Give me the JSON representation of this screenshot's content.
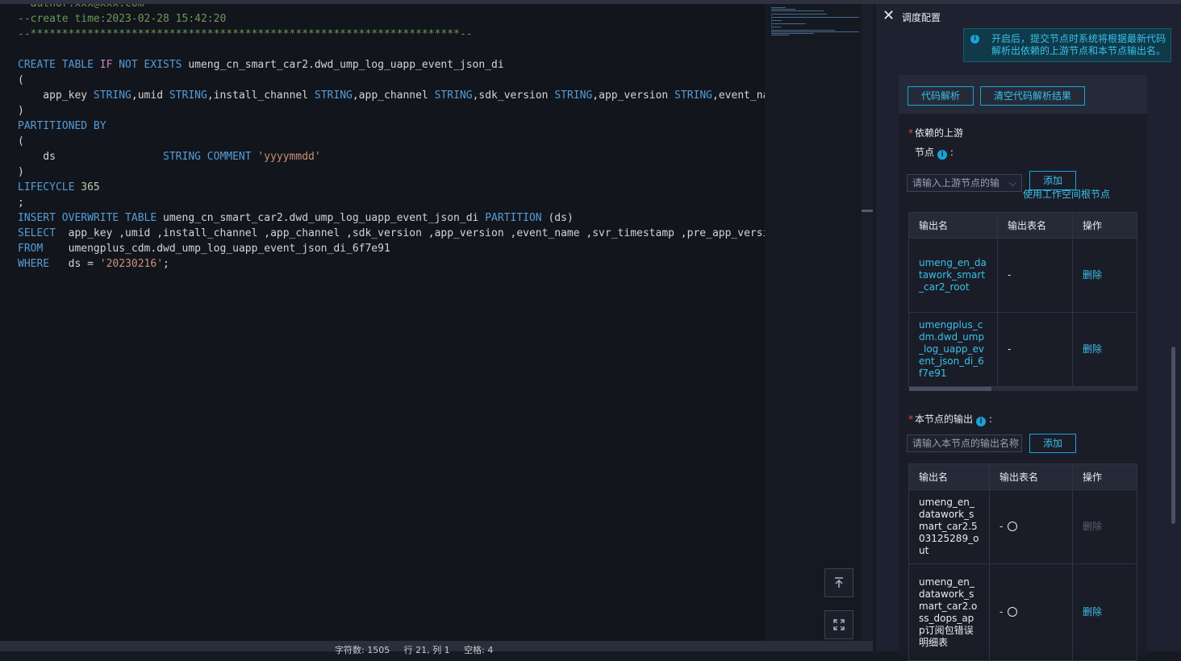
{
  "editor": {
    "lines": [
      {
        "parts": [
          [
            "cm",
            "--author:xxx@xxx.com"
          ]
        ]
      },
      {
        "parts": [
          [
            "cm",
            "--create time:2023-02-28 15:42:20"
          ]
        ]
      },
      {
        "parts": [
          [
            "cm",
            "--********************************************************************--"
          ]
        ]
      },
      {
        "parts": [
          [
            "",
            ""
          ]
        ]
      },
      {
        "parts": [
          [
            "kw",
            "CREATE TABLE "
          ],
          [
            "kw2",
            "IF"
          ],
          [
            "kw",
            " NOT EXISTS"
          ],
          [
            "",
            " umeng_cn_smart_car2.dwd_ump_log_uapp_event_json_di"
          ]
        ]
      },
      {
        "parts": [
          [
            "",
            "("
          ]
        ]
      },
      {
        "parts": [
          [
            "",
            "    app_key "
          ],
          [
            "ty",
            "STRING"
          ],
          [
            "",
            ",umid "
          ],
          [
            "ty",
            "STRING"
          ],
          [
            "",
            ",install_channel "
          ],
          [
            "ty",
            "STRING"
          ],
          [
            "",
            ",app_channel "
          ],
          [
            "ty",
            "STRING"
          ],
          [
            "",
            ",sdk_version "
          ],
          [
            "ty",
            "STRING"
          ],
          [
            "",
            ",app_version "
          ],
          [
            "ty",
            "STRING"
          ],
          [
            "",
            ",event_name"
          ]
        ]
      },
      {
        "parts": [
          [
            "",
            ")"
          ]
        ]
      },
      {
        "parts": [
          [
            "kw",
            "PARTITIONED BY"
          ]
        ]
      },
      {
        "parts": [
          [
            "",
            "("
          ]
        ]
      },
      {
        "parts": [
          [
            "",
            "    ds                 "
          ],
          [
            "ty",
            "STRING COMMENT "
          ],
          [
            "str",
            "'yyyymmdd'"
          ]
        ]
      },
      {
        "parts": [
          [
            "",
            ")"
          ]
        ]
      },
      {
        "parts": [
          [
            "kw",
            "LIFECYCLE "
          ],
          [
            "num",
            "365"
          ]
        ]
      },
      {
        "parts": [
          [
            "",
            ";"
          ]
        ]
      },
      {
        "parts": [
          [
            "kw",
            "INSERT OVERWRITE TABLE"
          ],
          [
            "",
            " umeng_cn_smart_car2.dwd_ump_log_uapp_event_json_di "
          ],
          [
            "kw",
            "PARTITION"
          ],
          [
            "",
            " (ds)"
          ]
        ]
      },
      {
        "parts": [
          [
            "kw",
            "SELECT"
          ],
          [
            "",
            "  app_key ,umid ,install_channel ,app_channel ,sdk_version ,app_version ,event_name ,svr_timestamp ,pre_app_version"
          ]
        ]
      },
      {
        "parts": [
          [
            "kw",
            "FROM"
          ],
          [
            "",
            "    umengplus_cdm.dwd_ump_log_uapp_event_json_di_6f7e91"
          ]
        ]
      },
      {
        "parts": [
          [
            "kw",
            "WHERE"
          ],
          [
            "",
            "   ds = "
          ],
          [
            "str",
            "'20230216'"
          ],
          [
            "",
            ";"
          ]
        ]
      }
    ]
  },
  "status_bar": {
    "text": "字符数: 1505     行 21, 列 1     空格: 4"
  },
  "panel": {
    "title": "调度配置",
    "info": "开启后，提交节点时系统将根据最新代码解析出依赖的上游节点和本节点输出名。",
    "buttons": {
      "parse": "代码解析",
      "clear": "清空代码解析结果"
    },
    "upstream": {
      "label": "依赖的上游",
      "node_label": "节点",
      "select_placeholder": "请输入上游节点的输",
      "add": "添加",
      "root_link": "使用工作空间根节点",
      "headers": [
        "输出名",
        "输出表名",
        "操作"
      ],
      "rows": [
        {
          "name": "umeng_en_datawork_smart_car2_root",
          "table": "-",
          "op": "删除"
        },
        {
          "name": "umengplus_cdm.dwd_ump_log_uapp_event_json_di_6f7e91",
          "table": "-",
          "op": "删除"
        }
      ]
    },
    "output": {
      "label": "本节点的输出",
      "input_placeholder": "请输入本节点的输出名称",
      "add": "添加",
      "headers": [
        "输出名",
        "输出表名",
        "操作"
      ],
      "rows": [
        {
          "name": "umeng_en_datawork_smart_car2.503125289_out",
          "table": "-",
          "op": "删除"
        },
        {
          "name": "umeng_en_datawork_smart_car2.oss_dops_app订阅包错误明细表",
          "table": "-",
          "op": "删除"
        }
      ]
    }
  }
}
